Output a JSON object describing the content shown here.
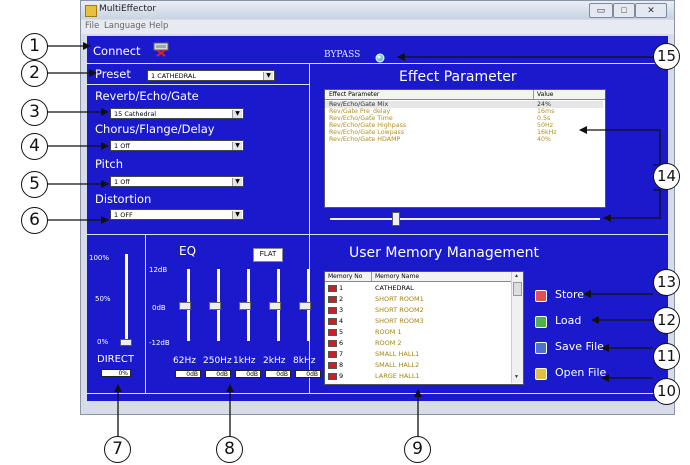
{
  "window": {
    "title": "MultiEffector",
    "controls": {
      "minimize": "▭",
      "maximize": "□",
      "close": "✕"
    }
  },
  "menu": [
    "File",
    "Language",
    "Help"
  ],
  "connect": {
    "label": "Connect"
  },
  "bypass": {
    "label": "BYPASS"
  },
  "preset": {
    "label": "Preset",
    "value": "1 CATHEDRAL"
  },
  "sections": {
    "reverb": {
      "label": "Reverb/Echo/Gate",
      "value": "15 Cathedral"
    },
    "chorus": {
      "label": "Chorus/Flange/Delay",
      "value": "1 Off"
    },
    "pitch": {
      "label": "Pitch",
      "value": "1 Off"
    },
    "distortion": {
      "label": "Distortion",
      "value": "1 OFF"
    }
  },
  "effect_parameter": {
    "title": "Effect Parameter",
    "columns": [
      "Effect Parameter",
      "Value"
    ],
    "rows": [
      {
        "name": "Rev/Echo/Gate Mix",
        "value": "24%"
      },
      {
        "name": "Rev/Gate Pre_delay",
        "value": "16ms"
      },
      {
        "name": "Rev/Echo/Gate Time",
        "value": "0.5s"
      },
      {
        "name": "Rev/Echo/Gate Highpass",
        "value": "50Hz"
      },
      {
        "name": "Rev/Echo/Gate Lowpass",
        "value": "16kHz"
      },
      {
        "name": "Rev/Echo/Gate HDAMP",
        "value": "40%"
      }
    ],
    "slider_level": 0.24
  },
  "direct": {
    "label": "DIRECT",
    "value": "0%",
    "scale": [
      "100%",
      "50%",
      "0%"
    ],
    "level": 0.0
  },
  "eq": {
    "title": "EQ",
    "flat_label": "FLAT",
    "scale": [
      "12dB",
      "0dB",
      "-12dB"
    ],
    "bands": [
      {
        "freq": "62Hz",
        "value": "0dB",
        "level": 0.5
      },
      {
        "freq": "250Hz",
        "value": "0dB",
        "level": 0.5
      },
      {
        "freq": "1kHz",
        "value": "0dB",
        "level": 0.5
      },
      {
        "freq": "2kHz",
        "value": "0dB",
        "level": 0.5
      },
      {
        "freq": "8kHz",
        "value": "0dB",
        "level": 0.5
      }
    ]
  },
  "memory": {
    "title": "User Memory Management",
    "columns": [
      "Memory No",
      "Memory Name"
    ],
    "rows": [
      {
        "no": "1",
        "name": "CATHEDRAL"
      },
      {
        "no": "2",
        "name": "SHORT ROOM1"
      },
      {
        "no": "3",
        "name": "SHORT ROOM2"
      },
      {
        "no": "4",
        "name": "SHORT ROOM3"
      },
      {
        "no": "5",
        "name": "ROOM 1"
      },
      {
        "no": "6",
        "name": "ROOM 2"
      },
      {
        "no": "7",
        "name": "SMALL HALL1"
      },
      {
        "no": "8",
        "name": "SMALL HALL2"
      },
      {
        "no": "9",
        "name": "LARGE HALL1"
      }
    ],
    "buttons": {
      "store": "Store",
      "load": "Load",
      "save_file": "Save File",
      "open_file": "Open File"
    }
  },
  "callouts": [
    "1",
    "2",
    "3",
    "4",
    "5",
    "6",
    "7",
    "8",
    "9",
    "10",
    "11",
    "12",
    "13",
    "14",
    "15"
  ],
  "colors": {
    "panel_bg": "#1a1acc",
    "text": "#ffffff",
    "param_text": "#b39020"
  }
}
